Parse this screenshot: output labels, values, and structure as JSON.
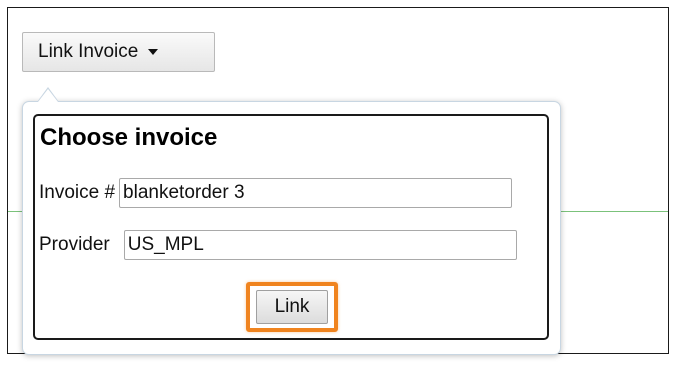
{
  "toolbar": {
    "link_invoice_label": "Link Invoice"
  },
  "popover": {
    "title": "Choose invoice",
    "invoice_label": "Invoice #",
    "invoice_value": "blanketorder 3",
    "provider_label": "Provider",
    "provider_value": "US_MPL",
    "link_button_label": "Link"
  },
  "colors": {
    "highlight": "#f0841f",
    "divider": "#7bc27b"
  },
  "icons": {
    "dropdown": "caret-down-icon"
  }
}
